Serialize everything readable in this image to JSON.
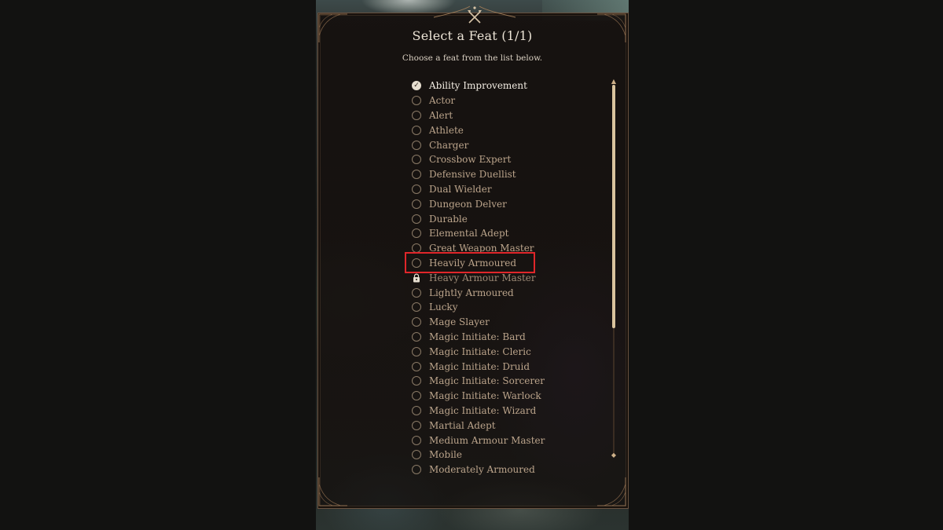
{
  "dialog": {
    "title": "Select a Feat (1/1)",
    "subtitle": "Choose a feat from the list below."
  },
  "feats": [
    {
      "label": "Ability Improvement",
      "state": "checked"
    },
    {
      "label": "Actor",
      "state": "unchecked"
    },
    {
      "label": "Alert",
      "state": "unchecked"
    },
    {
      "label": "Athlete",
      "state": "unchecked"
    },
    {
      "label": "Charger",
      "state": "unchecked"
    },
    {
      "label": "Crossbow Expert",
      "state": "unchecked"
    },
    {
      "label": "Defensive Duellist",
      "state": "unchecked"
    },
    {
      "label": "Dual Wielder",
      "state": "unchecked"
    },
    {
      "label": "Dungeon Delver",
      "state": "unchecked"
    },
    {
      "label": "Durable",
      "state": "unchecked"
    },
    {
      "label": "Elemental Adept",
      "state": "unchecked"
    },
    {
      "label": "Great Weapon Master",
      "state": "unchecked"
    },
    {
      "label": "Heavily Armoured",
      "state": "unchecked",
      "highlighted": true
    },
    {
      "label": "Heavy Armour Master",
      "state": "locked"
    },
    {
      "label": "Lightly Armoured",
      "state": "unchecked"
    },
    {
      "label": "Lucky",
      "state": "unchecked"
    },
    {
      "label": "Mage Slayer",
      "state": "unchecked"
    },
    {
      "label": "Magic Initiate: Bard",
      "state": "unchecked"
    },
    {
      "label": "Magic Initiate: Cleric",
      "state": "unchecked"
    },
    {
      "label": "Magic Initiate: Druid",
      "state": "unchecked"
    },
    {
      "label": "Magic Initiate: Sorcerer",
      "state": "unchecked"
    },
    {
      "label": "Magic Initiate: Warlock",
      "state": "unchecked"
    },
    {
      "label": "Magic Initiate: Wizard",
      "state": "unchecked"
    },
    {
      "label": "Martial Adept",
      "state": "unchecked"
    },
    {
      "label": "Medium Armour Master",
      "state": "unchecked"
    },
    {
      "label": "Mobile",
      "state": "unchecked"
    },
    {
      "label": "Moderately Armoured",
      "state": "unchecked"
    }
  ],
  "icons": {
    "checked": "check-icon",
    "locked": "lock-icon",
    "header": "crossed-axes-icon"
  },
  "colors": {
    "highlight": "#e0262a",
    "accent": "#d9c39d"
  }
}
